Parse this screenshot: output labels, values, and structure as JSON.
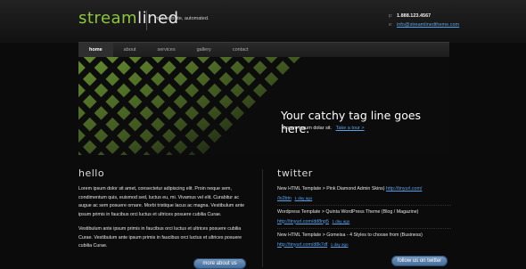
{
  "brand": {
    "logo_green": "stream",
    "logo_white": "lined",
    "tagline": "your website, automated."
  },
  "contact": {
    "phone_icon": "p:",
    "phone": "1.888.123.4567",
    "email_icon": "e:",
    "email": "info@streamlinedtheme.com"
  },
  "nav": {
    "items": [
      "home",
      "about",
      "services",
      "gallery",
      "contact"
    ]
  },
  "hero": {
    "headline": "Your catchy tag line goes here.",
    "sub": "Lorem ipsum dolar sit.",
    "link": "Take a tour >"
  },
  "hello": {
    "title": "hello",
    "p1": "Lorem ipsum dolor sit amet, consectetur adipiscing elit. Proin neque sem, condimentum quis, euismod sed, luctus eu, mi. Vivamus vel elit. Curabitur ac augue ac sem posuere ornare. Morbi tristique lacus ac magna. Vestibulum ante ipsum primis in faucibus orci luctus et ultrices posuere cubilia Curae.",
    "p2": "Vestibulum ante ipsum primis in faucibus orci luctus et ultrices posuere cubilia Curae. Vestibulum ante ipsum primis in faucibus orci luctus et ultrices posuere cubilia Curae.",
    "button": "more about us"
  },
  "twitter": {
    "title": "twitter",
    "tweets": [
      {
        "text": "New HTML Template > Pink Diamond Admin Skins)",
        "link": "http://tinyurl.com/",
        "link2": "/lo2btn",
        "ago": "1 day ago"
      },
      {
        "text": "Wordpress Template > Quinta WordPress Theme (Blog / Magazine)",
        "link": "http://tinyurl.com/dd8np5",
        "link2": "",
        "ago": "1 day ago"
      },
      {
        "text": "New HTML Template > Gomeisa - 4 Styles to choose from (Business)",
        "link": "http://tinyurl.com/d8k7df",
        "link2": "",
        "ago": "1 day ago"
      }
    ],
    "button": "follow us on twitter"
  },
  "colors": {
    "accent_green": "#8cc63f",
    "link_blue": "#5aa0e8",
    "button_blue": "#4f78a6"
  }
}
